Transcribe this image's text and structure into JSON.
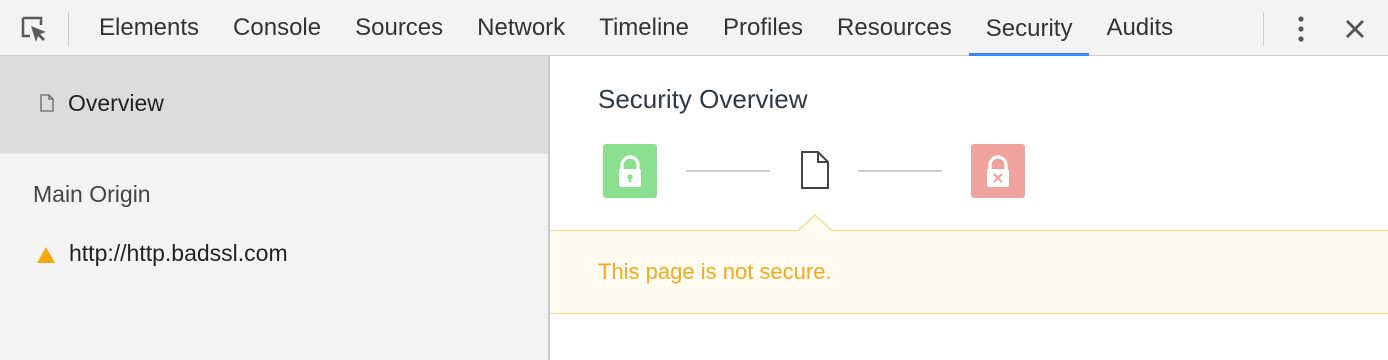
{
  "toolbar": {
    "tabs": [
      {
        "label": "Elements"
      },
      {
        "label": "Console"
      },
      {
        "label": "Sources"
      },
      {
        "label": "Network"
      },
      {
        "label": "Timeline"
      },
      {
        "label": "Profiles"
      },
      {
        "label": "Resources"
      },
      {
        "label": "Security",
        "selected": true
      },
      {
        "label": "Audits"
      }
    ],
    "selected_tab": "Security",
    "accent_color": "#3e82f7"
  },
  "sidebar": {
    "overview_label": "Overview",
    "heading": "Main Origin",
    "origin": {
      "url": "http://http.badssl.com",
      "status_icon": "warning-triangle-icon",
      "status_color": "#f4a80a"
    }
  },
  "main": {
    "title": "Security Overview",
    "indicators": [
      {
        "icon": "lock-icon",
        "state": "secure",
        "color": "#8ae08f"
      },
      {
        "icon": "document-icon",
        "state": "neutral",
        "selected": true
      },
      {
        "icon": "lock-x-icon",
        "state": "insecure",
        "color": "#f0a39e"
      }
    ],
    "banner": {
      "message": "This page is not secure.",
      "text_color": "#f2a91e",
      "background": "#fffbf0"
    }
  }
}
